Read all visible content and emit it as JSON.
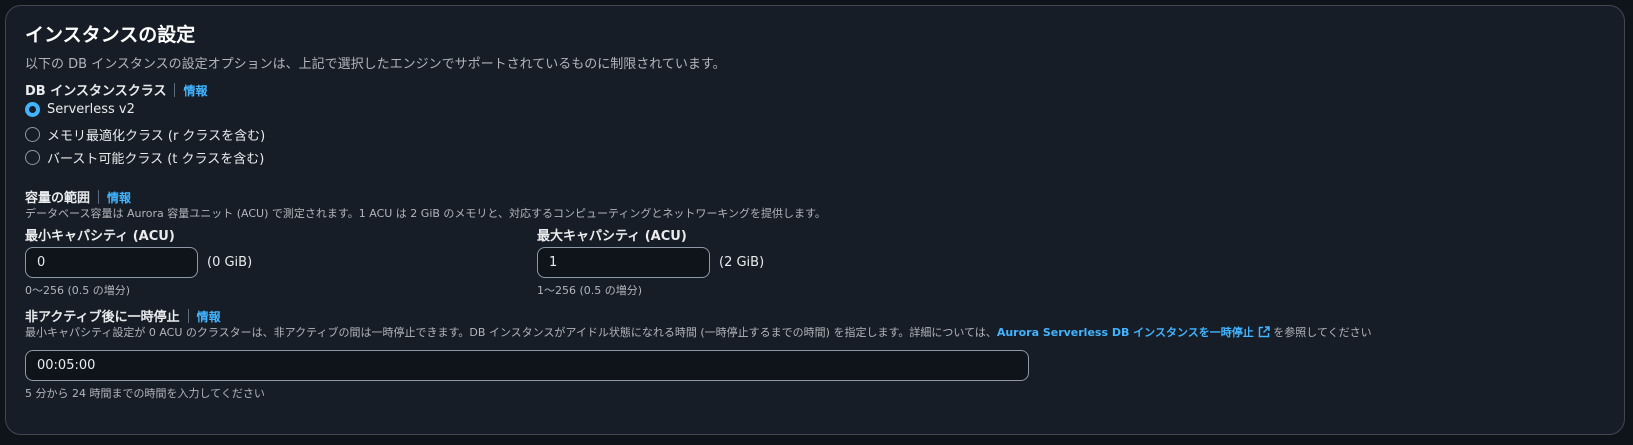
{
  "section": {
    "title": "インスタンスの設定",
    "description": "以下の DB インスタンスの設定オプションは、上記で選択したエンジンでサポートされているものに制限されています。"
  },
  "instance_class": {
    "label": "DB インスタンスクラス",
    "info": "情報",
    "options": [
      {
        "label": "Serverless v2",
        "checked": true
      },
      {
        "label": "メモリ最適化クラス (r クラスを含む)",
        "checked": false
      },
      {
        "label": "バースト可能クラス (t クラスを含む)",
        "checked": false
      }
    ]
  },
  "capacity": {
    "label": "容量の範囲",
    "info": "情報",
    "description": "データベース容量は Aurora 容量ユニット (ACU) で測定されます。1 ACU は 2 GiB のメモリと、対応するコンピューティングとネットワーキングを提供します。",
    "min": {
      "label": "最小キャパシティ (ACU)",
      "value": "0",
      "unit": "(0 GiB)",
      "hint": "0〜256 (0.5 の増分)"
    },
    "max": {
      "label": "最大キャパシティ (ACU)",
      "value": "1",
      "unit": "(2 GiB)",
      "hint": "1〜256 (0.5 の増分)"
    }
  },
  "pause": {
    "label": "非アクティブ後に一時停止",
    "info": "情報",
    "description_prefix": "最小キャパシティ設定が 0 ACU のクラスターは、非アクティブの間は一時停止できます。DB インスタンスがアイドル状態になれる時間 (一時停止するまでの時間) を指定します。詳細については、",
    "link_text": "Aurora Serverless DB インスタンスを一時停止",
    "description_suffix": " を参照してください",
    "value": "00:05:00",
    "hint": "5 分から 24 時間までの時間を入力してください"
  },
  "colors": {
    "accent": "#42b4ff",
    "background": "#161d26"
  }
}
